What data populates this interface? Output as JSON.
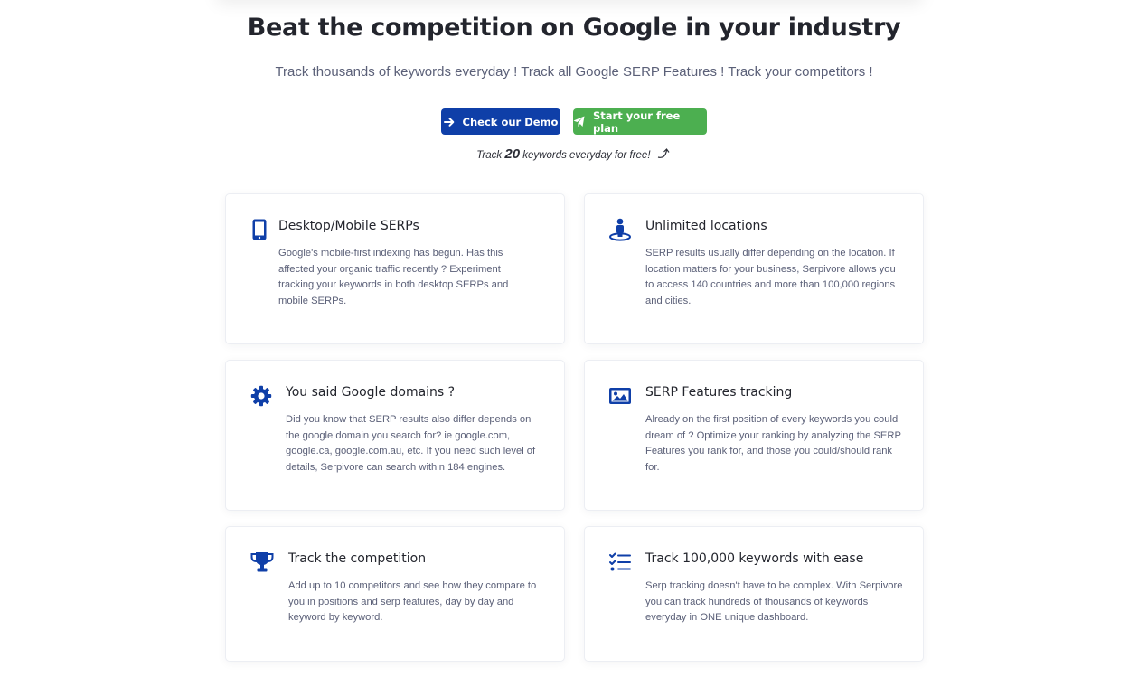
{
  "hero": {
    "title": "Beat the competition on Google in your industry",
    "subtitle": "Track thousands of keywords everyday ! Track all Google SERP Features ! Track your competitors !",
    "demo_button": "Check our Demo",
    "free_button": "Start your free plan",
    "free_note_prefix": "Track",
    "free_note_number": "20",
    "free_note_suffix": "keywords everyday for free!"
  },
  "features": [
    {
      "icon": "mobile-phone-icon",
      "title": "Desktop/Mobile SERPs",
      "text": "Google's mobile-first indexing has begun. Has this affected your organic traffic recently ? Experiment tracking your keywords in both desktop SERPs and mobile SERPs."
    },
    {
      "icon": "street-view-icon",
      "title": "Unlimited locations",
      "text": "SERP results usually differ depending on the location. If location matters for your business, Serpivore allows you to access 140 countries and more than 100,000 regions and cities."
    },
    {
      "icon": "gear-icon",
      "title": "You said Google domains ?",
      "text": "Did you know that SERP results also differ depends on the google domain you search for? ie google.com, google.ca, google.com.au, etc. If you need such level of details, Serpivore can search within 184 engines."
    },
    {
      "icon": "image-icon",
      "title": "SERP Features tracking",
      "text": "Already on the first position of every keywords you could dream of ? Optimize your ranking by analyzing the SERP Features you rank for, and those you could/should rank for."
    },
    {
      "icon": "trophy-icon",
      "title": "Track the competition",
      "text": "Add up to 10 competitors and see how they compare to you in positions and serp features, day by day and keyword by keyword."
    },
    {
      "icon": "checklist-icon",
      "title": "Track 100,000 keywords with ease",
      "text": "Serp tracking doesn't have to be complex. With Serpivore you can track hundreds of thousands of keywords everyday in ONE unique dashboard."
    }
  ],
  "colors": {
    "primary": "#0f3fa8",
    "success": "#4caf50",
    "icon": "#0f3fa8"
  }
}
